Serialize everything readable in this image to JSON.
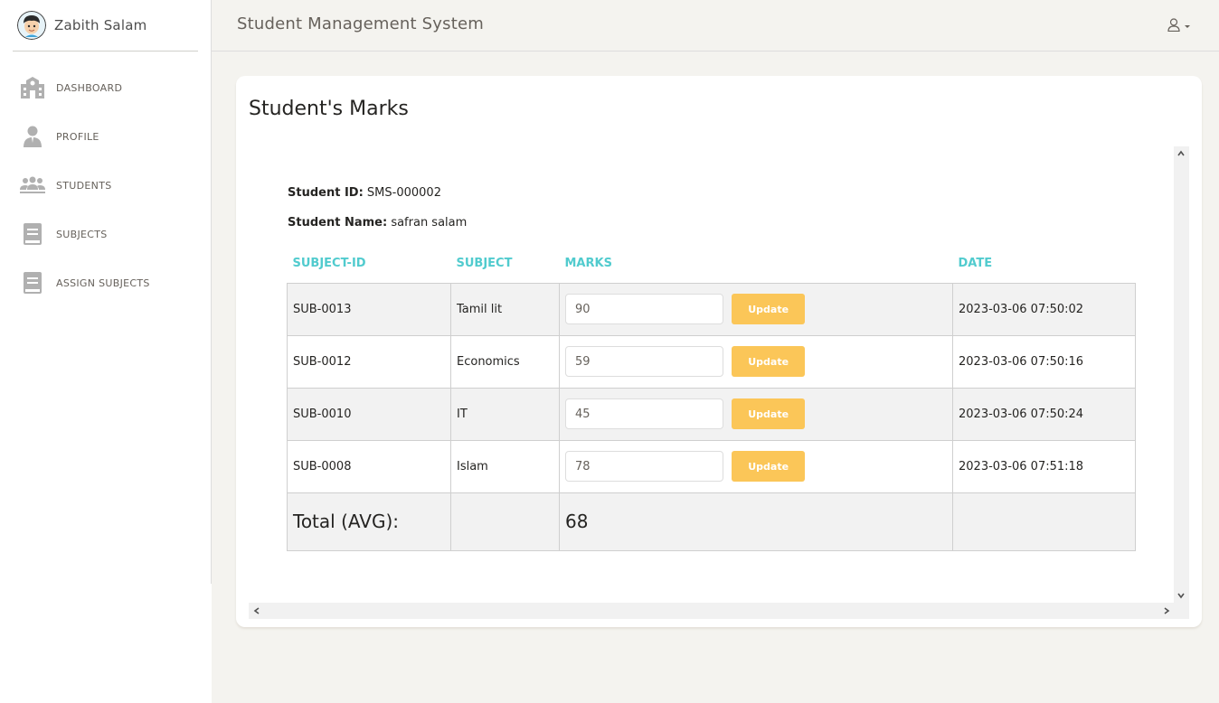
{
  "sidebar": {
    "user_name": "Zabith Salam",
    "items": [
      {
        "label": "DASHBOARD",
        "icon": "school-building-icon"
      },
      {
        "label": "PROFILE",
        "icon": "user-icon"
      },
      {
        "label": "STUDENTS",
        "icon": "users-group-icon"
      },
      {
        "label": "SUBJECTS",
        "icon": "book-icon"
      },
      {
        "label": "ASSIGN SUBJECTS",
        "icon": "book-icon"
      }
    ]
  },
  "header": {
    "title": "Student Management System"
  },
  "card": {
    "title": "Student's Marks",
    "student_id_label": "Student ID:",
    "student_id": "SMS-000002",
    "student_name_label": "Student Name:",
    "student_name": "safran salam"
  },
  "table": {
    "headers": [
      "SUBJECT-ID",
      "SUBJECT",
      "MARKS",
      "DATE"
    ],
    "rows": [
      {
        "subject_id": "SUB-0013",
        "subject": "Tamil lit",
        "marks": "90",
        "date": "2023-03-06 07:50:02"
      },
      {
        "subject_id": "SUB-0012",
        "subject": "Economics",
        "marks": "59",
        "date": "2023-03-06 07:50:16"
      },
      {
        "subject_id": "SUB-0010",
        "subject": "IT",
        "marks": "45",
        "date": "2023-03-06 07:50:24"
      },
      {
        "subject_id": "SUB-0008",
        "subject": "Islam",
        "marks": "78",
        "date": "2023-03-06 07:51:18"
      }
    ],
    "update_label": "Update",
    "total_label": "Total (AVG):",
    "total_value": "68"
  },
  "colors": {
    "accent": "#51cbce",
    "warning": "#fbc658"
  }
}
